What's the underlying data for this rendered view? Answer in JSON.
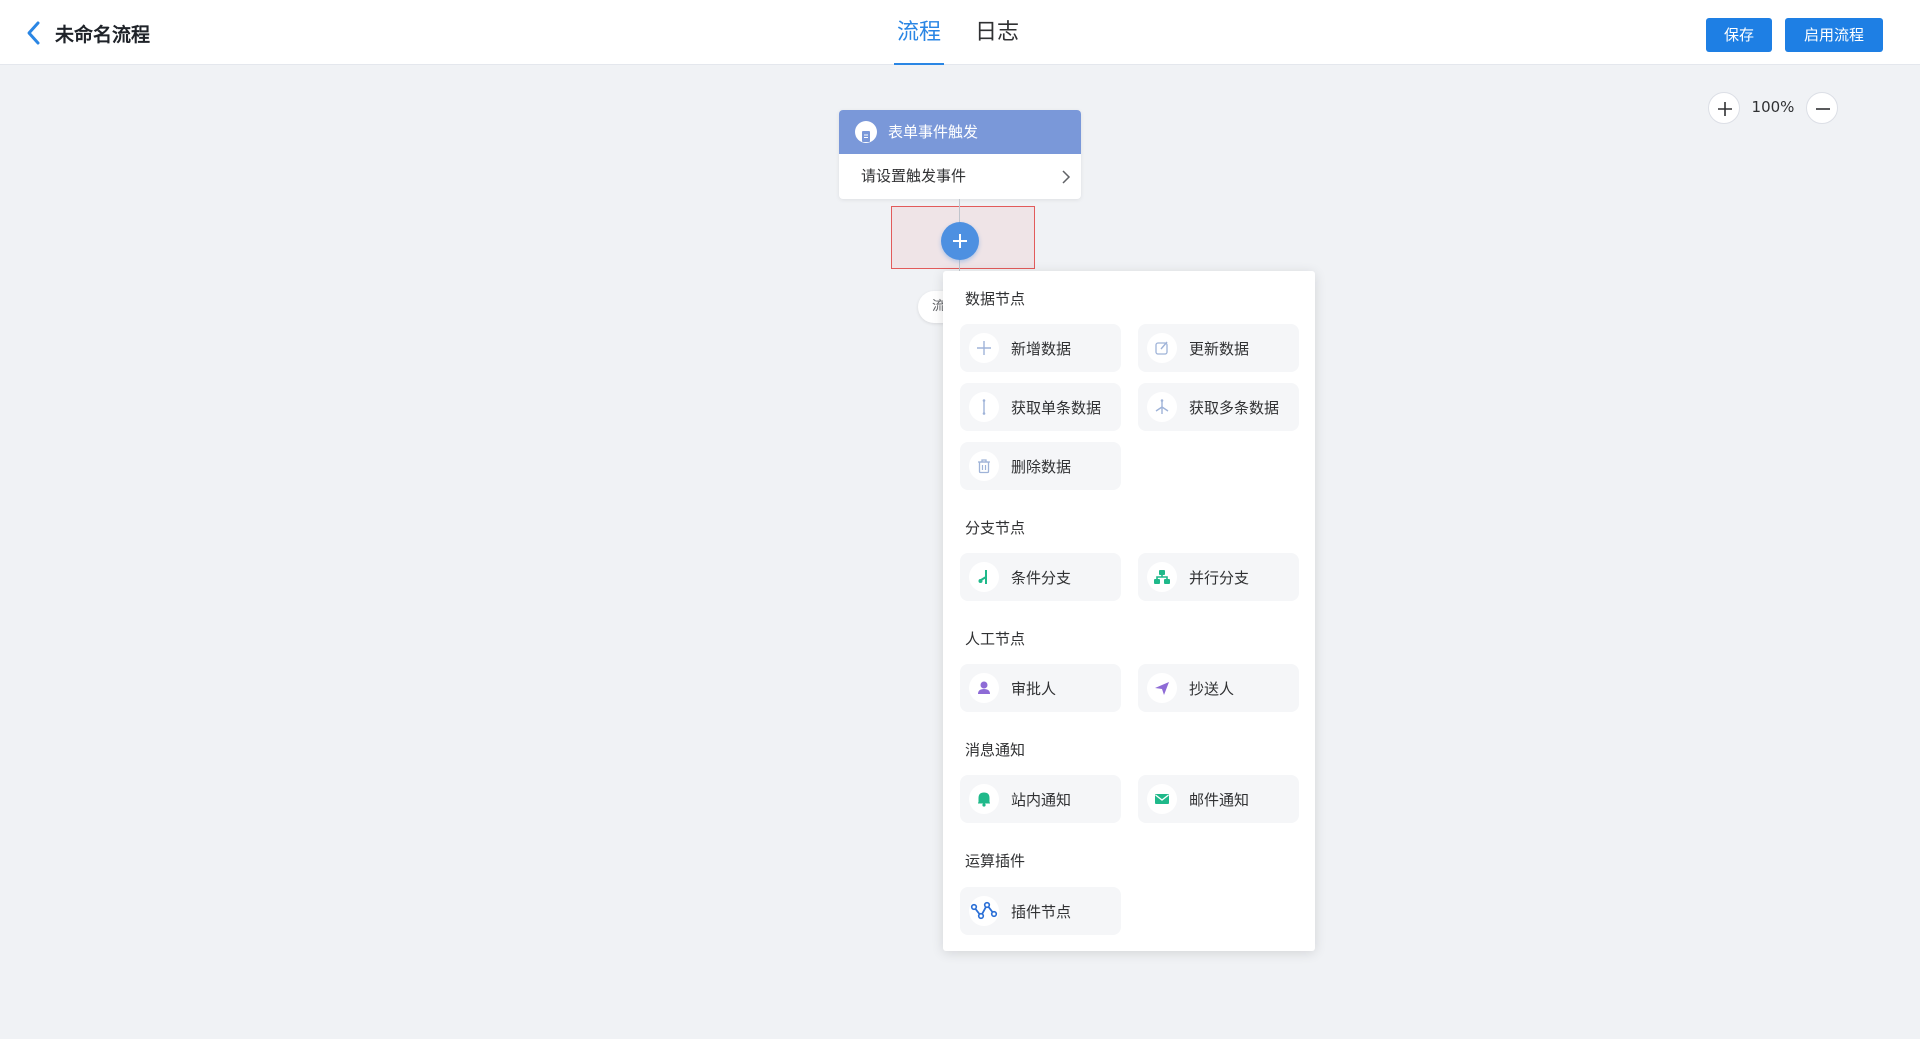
{
  "header": {
    "title": "未命名流程",
    "tabs": [
      {
        "label": "流程",
        "active": true
      },
      {
        "label": "日志",
        "active": false
      }
    ],
    "save_label": "保存",
    "enable_label": "启用流程"
  },
  "zoom": {
    "level": "100%"
  },
  "trigger_node": {
    "title": "表单事件触发",
    "placeholder": "请设置触发事件"
  },
  "end_label": "流",
  "colors": {
    "primary": "#1e7fe4",
    "node_header": "#7a98d9",
    "add_button": "#4d90e1",
    "highlight_border": "#e25b5b",
    "branch_green": "#1fb98a",
    "manual_purple": "#8e6bd6"
  },
  "menu": {
    "sections": [
      {
        "title": "数据节点",
        "items": [
          {
            "label": "新增数据",
            "icon": "plus-icon"
          },
          {
            "label": "更新数据",
            "icon": "edit-icon"
          },
          {
            "label": "获取单条数据",
            "icon": "single-record-icon"
          },
          {
            "label": "获取多条数据",
            "icon": "multi-record-icon"
          },
          {
            "label": "删除数据",
            "icon": "trash-icon"
          }
        ]
      },
      {
        "title": "分支节点",
        "items": [
          {
            "label": "条件分支",
            "icon": "condition-branch-icon"
          },
          {
            "label": "并行分支",
            "icon": "parallel-branch-icon"
          }
        ]
      },
      {
        "title": "人工节点",
        "items": [
          {
            "label": "审批人",
            "icon": "approver-icon"
          },
          {
            "label": "抄送人",
            "icon": "send-icon"
          }
        ]
      },
      {
        "title": "消息通知",
        "items": [
          {
            "label": "站内通知",
            "icon": "bell-icon"
          },
          {
            "label": "邮件通知",
            "icon": "mail-icon"
          }
        ]
      },
      {
        "title": "运算插件",
        "items": [
          {
            "label": "插件节点",
            "icon": "plugin-icon"
          }
        ]
      }
    ]
  }
}
